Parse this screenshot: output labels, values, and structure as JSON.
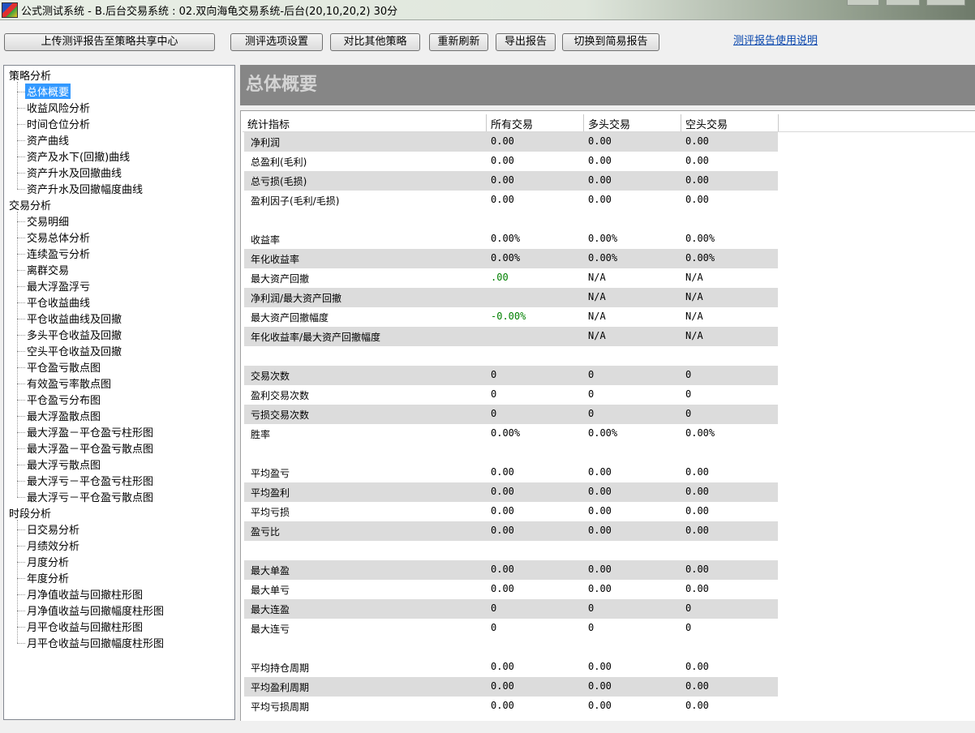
{
  "window": {
    "title": "公式测试系统 - B.后台交易系统 : 02.双向海龟交易系统-后台(20,10,20,2) 30分"
  },
  "toolbar": {
    "upload_label": "上传测评报告至策略共享中心",
    "options_label": "测评选项设置",
    "compare_label": "对比其他策略",
    "refresh_label": "重新刷新",
    "export_label": "导出报告",
    "simple_label": "切换到简易报告",
    "help_link": "测评报告使用说明"
  },
  "tree": {
    "groups": [
      {
        "label": "策略分析",
        "items": [
          "总体概要",
          "收益风险分析",
          "时间仓位分析",
          "资产曲线",
          "资产及水下(回撤)曲线",
          "资产升水及回撤曲线",
          "资产升水及回撤幅度曲线"
        ]
      },
      {
        "label": "交易分析",
        "items": [
          "交易明细",
          "交易总体分析",
          "连续盈亏分析",
          "离群交易",
          "最大浮盈浮亏",
          "平仓收益曲线",
          "平仓收益曲线及回撤",
          "多头平仓收益及回撤",
          "空头平仓收益及回撤",
          "平仓盈亏散点图",
          "有效盈亏率散点图",
          "平仓盈亏分布图",
          "最大浮盈散点图",
          "最大浮盈－平仓盈亏柱形图",
          "最大浮盈－平仓盈亏散点图",
          "最大浮亏散点图",
          "最大浮亏－平仓盈亏柱形图",
          "最大浮亏－平仓盈亏散点图"
        ]
      },
      {
        "label": "时段分析",
        "items": [
          "日交易分析",
          "月绩效分析",
          "月度分析",
          "年度分析",
          "月净值收益与回撤柱形图",
          "月净值收益与回撤幅度柱形图",
          "月平仓收益与回撤柱形图",
          "月平仓收益与回撤幅度柱形图"
        ]
      }
    ],
    "selected": "总体概要"
  },
  "main": {
    "title": "总体概要",
    "columns": [
      "统计指标",
      "所有交易",
      "多头交易",
      "空头交易"
    ],
    "rows": [
      [
        "净利润",
        "0.00",
        "0.00",
        "0.00"
      ],
      [
        "总盈利(毛利)",
        "0.00",
        "0.00",
        "0.00"
      ],
      [
        "总亏损(毛损)",
        "0.00",
        "0.00",
        "0.00"
      ],
      [
        "盈利因子(毛利/毛损)",
        "0.00",
        "0.00",
        "0.00"
      ],
      [
        "",
        "",
        "",
        ""
      ],
      [
        "收益率",
        "0.00%",
        "0.00%",
        "0.00%"
      ],
      [
        "年化收益率",
        "0.00%",
        "0.00%",
        "0.00%"
      ],
      [
        "最大资产回撤",
        ".00",
        "N/A",
        "N/A"
      ],
      [
        "净利润/最大资产回撤",
        "",
        "N/A",
        "N/A"
      ],
      [
        "最大资产回撤幅度",
        "-0.00%",
        "N/A",
        "N/A"
      ],
      [
        "年化收益率/最大资产回撤幅度",
        "",
        "N/A",
        "N/A"
      ],
      [
        "",
        "",
        "",
        ""
      ],
      [
        "交易次数",
        "0",
        "0",
        "0"
      ],
      [
        "盈利交易次数",
        "0",
        "0",
        "0"
      ],
      [
        "亏损交易次数",
        "0",
        "0",
        "0"
      ],
      [
        "胜率",
        "0.00%",
        "0.00%",
        "0.00%"
      ],
      [
        "",
        "",
        "",
        ""
      ],
      [
        "平均盈亏",
        "0.00",
        "0.00",
        "0.00"
      ],
      [
        "平均盈利",
        "0.00",
        "0.00",
        "0.00"
      ],
      [
        "平均亏损",
        "0.00",
        "0.00",
        "0.00"
      ],
      [
        "盈亏比",
        "0.00",
        "0.00",
        "0.00"
      ],
      [
        "",
        "",
        "",
        ""
      ],
      [
        "最大单盈",
        "0.00",
        "0.00",
        "0.00"
      ],
      [
        "最大单亏",
        "0.00",
        "0.00",
        "0.00"
      ],
      [
        "最大连盈",
        "0",
        "0",
        "0"
      ],
      [
        "最大连亏",
        "0",
        "0",
        "0"
      ],
      [
        "",
        "",
        "",
        ""
      ],
      [
        "平均持仓周期",
        "0.00",
        "0.00",
        "0.00"
      ],
      [
        "平均盈利周期",
        "0.00",
        "0.00",
        "0.00"
      ],
      [
        "平均亏损周期",
        "0.00",
        "0.00",
        "0.00"
      ]
    ],
    "highlight_color": "#008000"
  }
}
